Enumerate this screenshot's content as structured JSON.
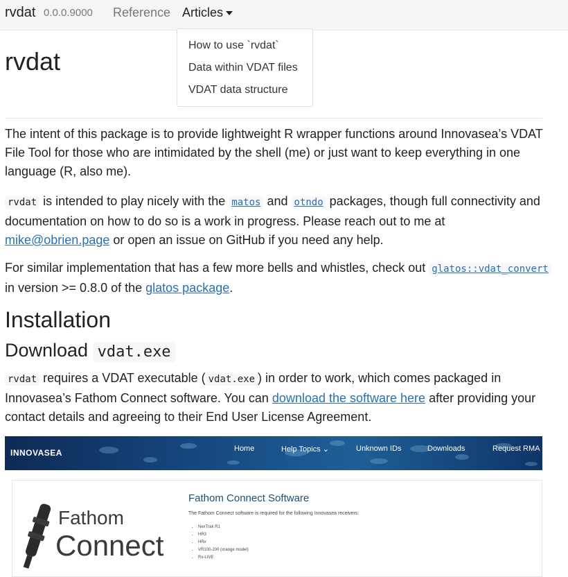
{
  "navbar": {
    "brand": "rvdat",
    "version": "0.0.0.9000",
    "reference_label": "Reference",
    "articles_label": "Articles"
  },
  "articles_menu": {
    "items": [
      "How to use `rvdat`",
      "Data within VDAT files",
      "VDAT data structure"
    ]
  },
  "main": {
    "title": "rvdat",
    "intro_paragraph": "The intent of this package is to provide lightweight R wrapper functions around Innovasea’s VDAT File Tool for those who are intimidated by the shell (me) or just want to keep everything in one language (R, also me).",
    "p2": {
      "code_rvdat": "rvdat",
      "text1": " is intended to play nicely with the ",
      "link_matos": "matos",
      "text2": " and ",
      "link_otndo": "otndo",
      "text3": " packages, though full connectivity and documentation on how to do so is a work in progress. Please reach out to me at ",
      "link_email": "mike@obrien.page",
      "text4": " or open an issue on GitHub if you need any help."
    },
    "p3": {
      "text1": "For similar implementation that has a few more bells and whistles, check out ",
      "link_glatos_func": "glatos::vdat_convert",
      "text2": " in version >= 0.8.0 of the ",
      "link_glatos_pkg": "glatos package",
      "text3": "."
    },
    "installation_heading": "Installation",
    "download_heading_text": "Download",
    "download_heading_code": "vdat.exe",
    "p4": {
      "code_rvdat": "rvdat",
      "text1": " requires a VDAT executable (",
      "code_vdat": "vdat.exe",
      "text2": ") in order to work, which comes packaged in Innovasea’s Fathom Connect software. You can ",
      "link_download": "download the software here",
      "text3": " after providing your contact details and agreeing to their End User License Agreement."
    }
  },
  "screenshot_banner": {
    "logo": "INNOVASEA",
    "nav": [
      "Home",
      "Help Topics ⌄",
      "Unknown IDs",
      "Downloads",
      "Request RMA"
    ]
  },
  "screenshot_card": {
    "brand_line1": "Fathom",
    "brand_line2": "Connect",
    "title": "Fathom Connect Software",
    "description": "The Fathom Connect software is required for the following Innovasea receivers:",
    "receivers": [
      "NexTrak R1",
      "HR3",
      "HRx",
      "VR100-200 (orange model)",
      "Rx-LIVE"
    ]
  },
  "colors": {
    "link": "#2a6fb0",
    "navbar_bg": "#f5f5f5",
    "banner_blue": "#16477f"
  }
}
